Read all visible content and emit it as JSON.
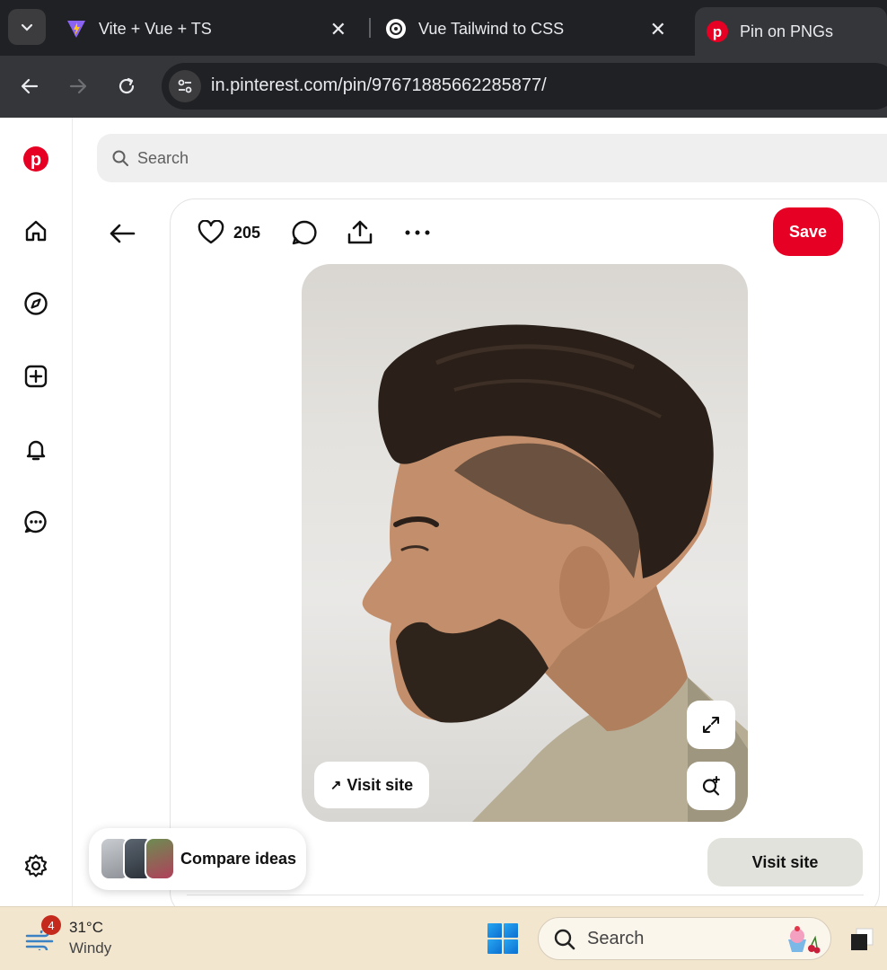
{
  "browser": {
    "tabs": [
      {
        "title": "Vite + Vue + TS",
        "icon": "vite-icon"
      },
      {
        "title": "Vue Tailwind to CSS",
        "icon": "openai-icon"
      },
      {
        "title": "Pin on PNGs",
        "icon": "pinterest-icon"
      }
    ],
    "url": "in.pinterest.com/pin/97671885662285877/"
  },
  "search": {
    "placeholder": "Search"
  },
  "pin": {
    "like_count": "205",
    "save_label": "Save",
    "visit_overlay_label": "Visit site",
    "visit_label": "Visit site"
  },
  "compare": {
    "label": "Compare ideas"
  },
  "taskbar": {
    "weather_badge": "4",
    "temperature": "31°C",
    "condition": "Windy",
    "search_placeholder": "Search"
  },
  "colors": {
    "pinterest_red": "#e60023",
    "chrome_dark": "#202124",
    "taskbar": "#f3e6cf"
  }
}
